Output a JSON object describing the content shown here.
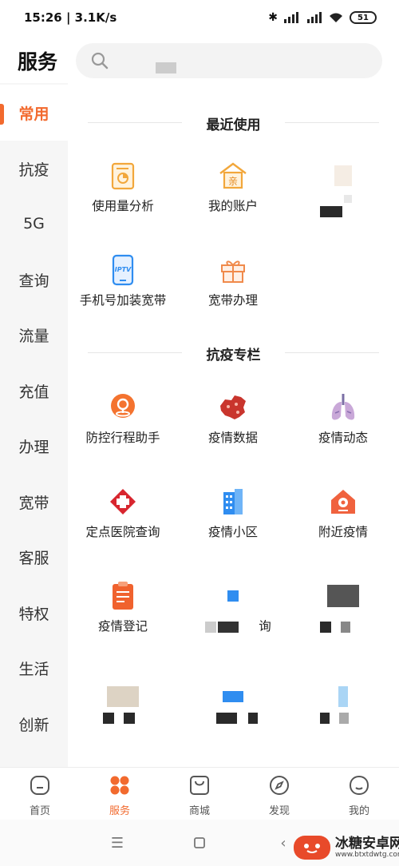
{
  "status_bar": {
    "time_speed": "15:26 | 3.1K/s",
    "battery": "51"
  },
  "header": {
    "title": "服务",
    "search_placeholder": ""
  },
  "sidebar": {
    "items": [
      {
        "label": "常用",
        "active": true
      },
      {
        "label": "抗疫"
      },
      {
        "label": "5G"
      },
      {
        "label": "查询"
      },
      {
        "label": "流量"
      },
      {
        "label": "充值"
      },
      {
        "label": "办理"
      },
      {
        "label": "宽带"
      },
      {
        "label": "客服"
      },
      {
        "label": "特权"
      },
      {
        "label": "生活"
      },
      {
        "label": "创新"
      }
    ]
  },
  "sections": {
    "recent": {
      "title": "最近使用",
      "items": [
        {
          "label": "使用量分析",
          "icon": "usage-analysis-icon"
        },
        {
          "label": "我的账户",
          "icon": "account-house-icon"
        },
        {
          "label": "",
          "icon": "blurred-icon"
        },
        {
          "label": "手机号加装宽带",
          "icon": "iptv-phone-icon"
        },
        {
          "label": "宽带办理",
          "icon": "gift-box-icon"
        }
      ]
    },
    "covid": {
      "title": "抗疫专栏",
      "items": [
        {
          "label": "防控行程助手",
          "icon": "location-pin-icon"
        },
        {
          "label": "疫情数据",
          "icon": "china-map-icon"
        },
        {
          "label": "疫情动态",
          "icon": "lungs-icon"
        },
        {
          "label": "定点医院查询",
          "icon": "hospital-cross-icon"
        },
        {
          "label": "疫情小区",
          "icon": "building-icon"
        },
        {
          "label": "附近疫情",
          "icon": "nearby-house-icon"
        },
        {
          "label": "疫情登记",
          "icon": "clipboard-icon"
        },
        {
          "label": "询",
          "icon": "blurred-icon"
        },
        {
          "label": "",
          "icon": "blurred-icon"
        },
        {
          "label": "",
          "icon": "blurred-icon"
        },
        {
          "label": "",
          "icon": "blurred-icon"
        },
        {
          "label": "",
          "icon": "blurred-icon"
        }
      ]
    }
  },
  "bottom_nav": {
    "items": [
      {
        "label": "首页",
        "icon": "home-icon"
      },
      {
        "label": "服务",
        "icon": "services-grid-icon",
        "active": true
      },
      {
        "label": "商城",
        "icon": "shopping-bag-icon"
      },
      {
        "label": "发现",
        "icon": "compass-icon"
      },
      {
        "label": "我的",
        "icon": "profile-face-icon"
      }
    ]
  },
  "watermark": {
    "name": "冰糖安卓网",
    "url": "www.btxtdwtg.com"
  },
  "colors": {
    "accent": "#f26a2e",
    "sidebar_bg": "#f6f6f6"
  }
}
